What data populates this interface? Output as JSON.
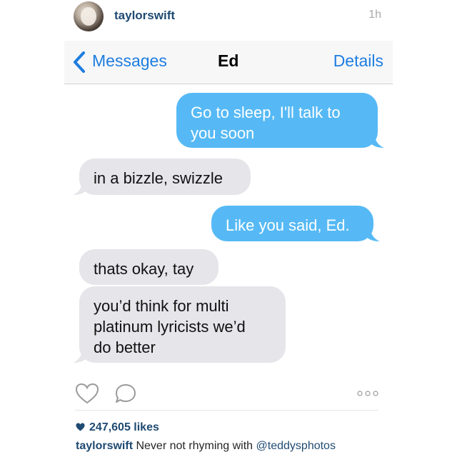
{
  "post": {
    "username": "taylorswift",
    "time": "1h",
    "likes": "247,605 likes",
    "caption_user": "taylorswift",
    "caption_text": " Never not rhyming with ",
    "caption_mention": "@teddysphotos"
  },
  "messages_app": {
    "back_label": "Messages",
    "title": "Ed",
    "details_label": "Details"
  },
  "chat": {
    "messages": [
      {
        "side": "out",
        "text": "Go to sleep, I'll talk to\nyou soon"
      },
      {
        "side": "in",
        "text": "in a bizzle, swizzle"
      },
      {
        "side": "out",
        "text": "Like you said, Ed."
      },
      {
        "side": "in",
        "text": "thats okay, tay"
      },
      {
        "side": "in",
        "text": "you’d think for multi\nplatinum lyricists we’d\ndo better"
      }
    ]
  },
  "icons": {
    "avatar": "profile-photo",
    "back": "chevron-left-icon",
    "like": "heart-icon",
    "comment": "comment-icon",
    "more": "more-dots-icon"
  },
  "colors": {
    "ios_blue": "#1e7de0",
    "outgoing_bubble": "#56b9f5",
    "incoming_bubble": "#e5e5ea",
    "instagram_link": "#1f4a72"
  }
}
